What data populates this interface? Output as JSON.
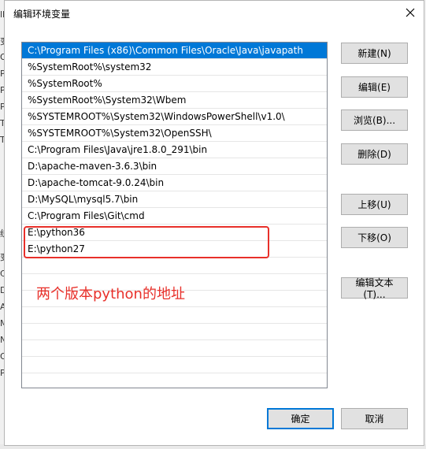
{
  "background_window": {
    "edge_chars": [
      "ll",
      "变",
      "O",
      "Pa",
      "Py",
      "Py",
      "TE",
      "TN",
      "统",
      "变",
      "Co",
      "Dr",
      "A",
      "M",
      "N",
      "O",
      "Pa"
    ]
  },
  "dialog": {
    "title": "编辑环境变量",
    "close_icon": "close-icon"
  },
  "path_list": {
    "selected_index": 0,
    "items": [
      "C:\\Program Files (x86)\\Common Files\\Oracle\\Java\\javapath",
      "%SystemRoot%\\system32",
      "%SystemRoot%",
      "%SystemRoot%\\System32\\Wbem",
      "%SYSTEMROOT%\\System32\\WindowsPowerShell\\v1.0\\",
      "%SYSTEMROOT%\\System32\\OpenSSH\\",
      "C:\\Program Files\\Java\\jre1.8.0_291\\bin",
      "D:\\apache-maven-3.6.3\\bin",
      "D:\\apache-tomcat-9.0.24\\bin",
      "D:\\MySQL\\mysql5.7\\bin",
      "C:\\Program Files\\Git\\cmd",
      "E:\\python36",
      "E:\\python27",
      "",
      "",
      "",
      "",
      "",
      "",
      "",
      ""
    ]
  },
  "buttons": {
    "new": "新建(N)",
    "edit": "编辑(E)",
    "browse": "浏览(B)...",
    "delete": "删除(D)",
    "move_up": "上移(U)",
    "move_down": "下移(O)",
    "edit_text": "编辑文本(T)...",
    "ok": "确定",
    "cancel": "取消"
  },
  "annotation": {
    "text": "两个版本python的地址",
    "color": "#e8302a"
  },
  "colors": {
    "selection": "#0078d7",
    "button_face": "#e1e1e1",
    "default_border": "#0078d7"
  }
}
